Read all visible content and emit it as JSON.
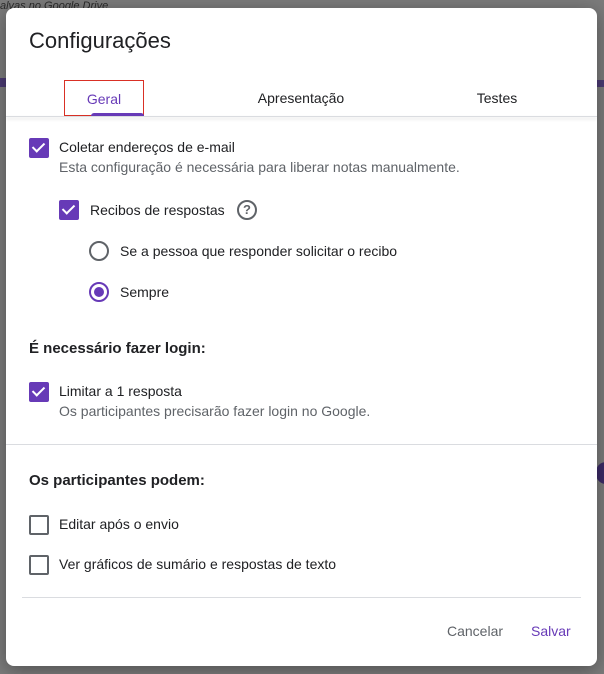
{
  "background": {
    "snippet": "alvas no Google Drive"
  },
  "dialog": {
    "title": "Configurações",
    "tabs": [
      {
        "label": "Geral",
        "selected": true
      },
      {
        "label": "Apresentação",
        "selected": false
      },
      {
        "label": "Testes",
        "selected": false
      }
    ],
    "collect_emails": {
      "label": "Coletar endereços de e-mail",
      "description": "Esta configuração é necessária para liberar notas manualmente.",
      "checked": true
    },
    "response_receipts": {
      "label": "Recibos de respostas",
      "checked": true,
      "help_icon": "help-circle-icon",
      "options": [
        {
          "label": "Se a pessoa que responder solicitar o recibo",
          "selected": false
        },
        {
          "label": "Sempre",
          "selected": true
        }
      ]
    },
    "login_section": {
      "title": "É necessário fazer login:",
      "limit_one": {
        "label": "Limitar a 1 resposta",
        "description": "Os participantes precisarão fazer login no Google.",
        "checked": true
      }
    },
    "participants_section": {
      "title": "Os participantes podem:",
      "edit_after_submit": {
        "label": "Editar após o envio",
        "checked": false
      },
      "see_summary": {
        "label": "Ver gráficos de sumário e respostas de texto",
        "checked": false
      }
    },
    "actions": {
      "cancel": "Cancelar",
      "save": "Salvar"
    }
  },
  "colors": {
    "accent": "#673ab7",
    "highlight_box": "#d93025",
    "text": "#202124",
    "secondary_text": "#5f6368"
  }
}
